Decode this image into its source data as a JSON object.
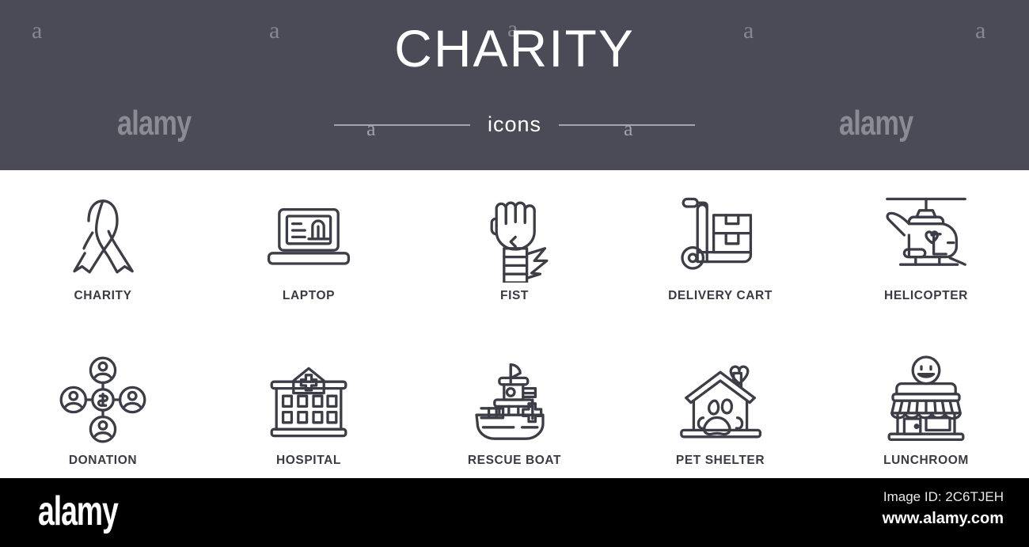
{
  "header": {
    "title": "CHARITY",
    "subtitle": "icons",
    "background_color": "#4b4b57",
    "title_color": "#ffffff",
    "rule_color": "#a4a4ae",
    "watermark_text": "alamy",
    "watermark_letter": "a"
  },
  "grid": {
    "columns": 5,
    "rows": 2,
    "icon_color": "#3d3d47",
    "label_color": "#3a3a44",
    "items": [
      {
        "label": "CHARITY",
        "icon": "ribbon-icon"
      },
      {
        "label": "LAPTOP",
        "icon": "laptop-icon"
      },
      {
        "label": "FIST",
        "icon": "fist-icon"
      },
      {
        "label": "DELIVERY CART",
        "icon": "delivery-cart-icon"
      },
      {
        "label": "HELICOPTER",
        "icon": "helicopter-icon"
      },
      {
        "label": "DONATION",
        "icon": "donation-network-icon"
      },
      {
        "label": "HOSPITAL",
        "icon": "hospital-icon"
      },
      {
        "label": "RESCUE BOAT",
        "icon": "rescue-boat-icon"
      },
      {
        "label": "PET SHELTER",
        "icon": "pet-shelter-icon"
      },
      {
        "label": "LUNCHROOM",
        "icon": "lunchroom-icon"
      }
    ]
  },
  "footer": {
    "logo": "alamy",
    "image_id": "Image ID: 2C6TJEH",
    "url": "www.alamy.com",
    "background_color": "#000000"
  }
}
